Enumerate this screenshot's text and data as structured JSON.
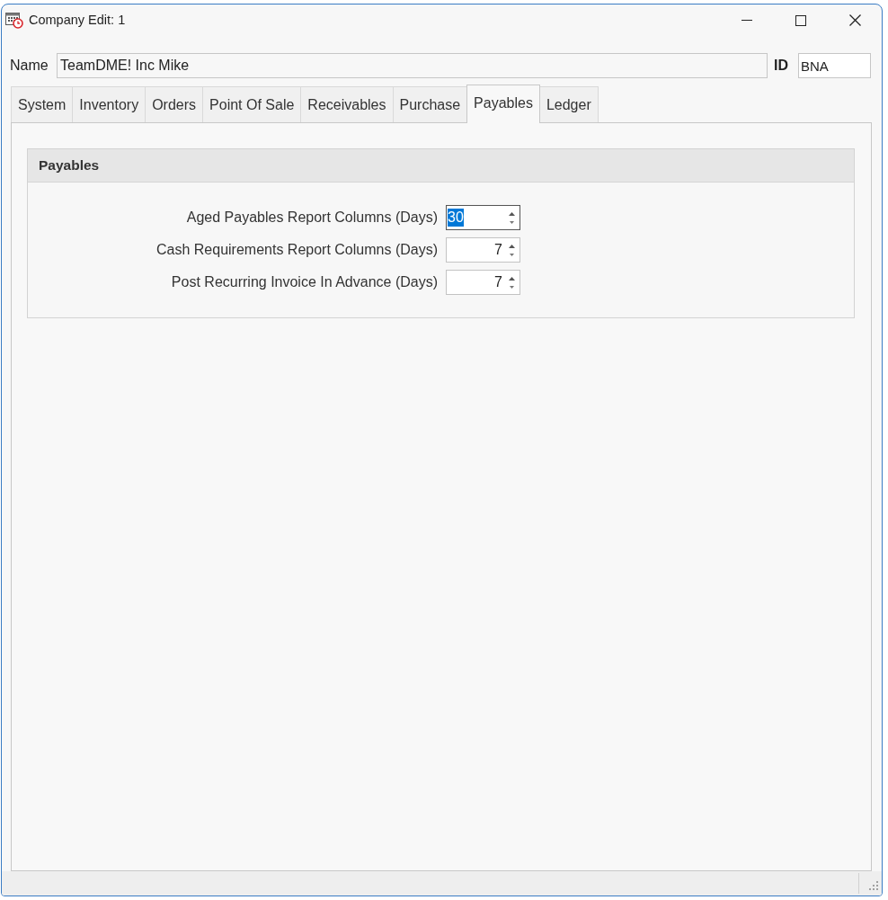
{
  "window": {
    "title": "Company Edit: 1"
  },
  "name_field": {
    "label": "Name",
    "value": "TeamDME! Inc Mike"
  },
  "id_field": {
    "label": "ID",
    "value": "BNA"
  },
  "tabs": [
    {
      "label": "System",
      "selected": false
    },
    {
      "label": "Inventory",
      "selected": false
    },
    {
      "label": "Orders",
      "selected": false
    },
    {
      "label": "Point Of Sale",
      "selected": false
    },
    {
      "label": "Receivables",
      "selected": false
    },
    {
      "label": "Purchase",
      "selected": false
    },
    {
      "label": "Payables",
      "selected": true
    },
    {
      "label": "Ledger",
      "selected": false
    }
  ],
  "group": {
    "title": "Payables",
    "fields": [
      {
        "label": "Aged Payables Report Columns (Days)",
        "value": "30",
        "focused": true
      },
      {
        "label": "Cash Requirements Report Columns (Days)",
        "value": "7",
        "focused": false
      },
      {
        "label": "Post Recurring Invoice In Advance (Days)",
        "value": "7",
        "focused": false
      }
    ]
  }
}
